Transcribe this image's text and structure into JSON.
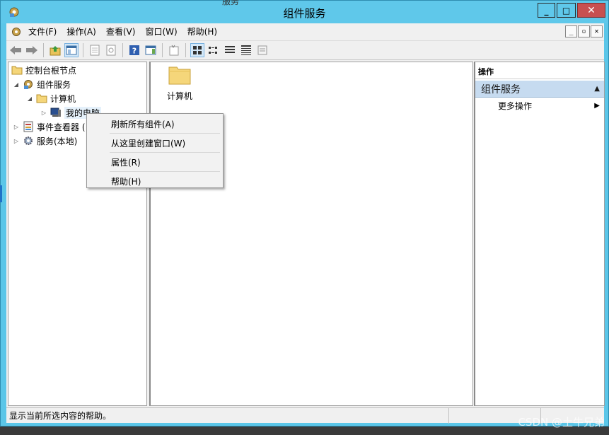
{
  "window": {
    "title": "组件服务",
    "behind_title_fragment": "服务",
    "buttons": {
      "minimize": "_",
      "maximize": "□",
      "close": "✕"
    }
  },
  "menu": {
    "items": [
      "文件(F)",
      "操作(A)",
      "查看(V)",
      "窗口(W)",
      "帮助(H)"
    ]
  },
  "mdi_buttons": [
    "_",
    "▫",
    "✕"
  ],
  "toolbar": {
    "icons": [
      "back-arrow-icon",
      "forward-arrow-icon",
      "up-folder-icon",
      "show-hide-console-tree-icon",
      "export-list-icon",
      "refresh-icon",
      "help-icon",
      "action-pane-toggle-icon",
      "new-window-icon",
      "large-icons-view-icon",
      "small-icons-view-icon",
      "list-view-icon",
      "detail-view-icon",
      "properties-view-icon"
    ]
  },
  "tree": {
    "items": [
      {
        "label": "控制台根节点",
        "icon": "folder-icon",
        "expander": ""
      },
      {
        "label": "组件服务",
        "icon": "component-services-icon",
        "expander": "◢"
      },
      {
        "label": "计算机",
        "icon": "folder-icon",
        "expander": "◢"
      },
      {
        "label": "我的电脑",
        "icon": "computer-icon",
        "expander": "▷"
      },
      {
        "label": "事件查看器 (",
        "icon": "event-viewer-icon",
        "expander": "▷"
      },
      {
        "label": "服务(本地)",
        "icon": "gear-icon",
        "expander": "▷"
      }
    ]
  },
  "main": {
    "items": [
      {
        "label": "计算机",
        "icon": "large-folder-icon"
      }
    ]
  },
  "actions": {
    "header": "操作",
    "section": "组件服务",
    "section_toggle": "▲",
    "items": [
      {
        "label": "更多操作",
        "arrow": "▶"
      }
    ]
  },
  "context_menu": {
    "items": [
      "刷新所有组件(A)",
      "从这里创建窗口(W)",
      "属性(R)",
      "帮助(H)"
    ]
  },
  "status": {
    "text": "显示当前所选内容的帮助。"
  },
  "watermark": "CSDN @土牛兄弟",
  "colors": {
    "titlebar": "#5fc8ea",
    "close": "#c75050",
    "action_section": "#c6dbf0",
    "folder": "#f5d67a"
  }
}
